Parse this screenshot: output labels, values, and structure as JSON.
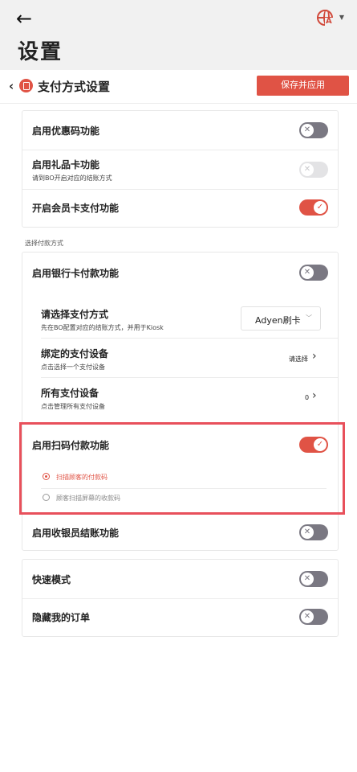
{
  "header": {
    "title": "设置",
    "language_badge": "A"
  },
  "subheader": {
    "title": "支付方式设置",
    "save_label": "保存并应用"
  },
  "card1": {
    "rows": [
      {
        "title": "启用优惠码功能",
        "toggle": "off"
      },
      {
        "title": "启用礼品卡功能",
        "subtitle": "请到BO开启对应的结账方式",
        "toggle": "disabled"
      },
      {
        "title": "开启会员卡支付功能",
        "toggle": "on"
      }
    ]
  },
  "section_label": "选择付款方式",
  "card2": {
    "bank_card": {
      "title": "启用银行卡付款功能",
      "toggle": "off"
    },
    "payment_method": {
      "title": "请选择支付方式",
      "subtitle": "先在BO配置对应的结账方式，并用于Kiosk",
      "selected_value": "Adyen刷卡"
    },
    "bound_device": {
      "title": "绑定的支付设备",
      "subtitle": "点击选择一个支付设备",
      "value": "请选择"
    },
    "all_devices": {
      "title": "所有支付设备",
      "subtitle": "点击管理所有支付设备",
      "value": "0"
    },
    "scan_pay": {
      "title": "启用扫码付款功能",
      "toggle": "on",
      "options": [
        {
          "label": "扫描顾客的付款码",
          "selected": true
        },
        {
          "label": "顾客扫描屏幕的收款码",
          "selected": false
        }
      ]
    },
    "cashier_checkout": {
      "title": "启用收银员结账功能",
      "toggle": "off"
    }
  },
  "card3": {
    "rows": [
      {
        "title": "快速模式",
        "toggle": "off"
      },
      {
        "title": "隐藏我的订单",
        "toggle": "off"
      }
    ]
  },
  "colors": {
    "accent": "#e05345",
    "highlight_border": "#e8505b",
    "toggle_off": "#7a7882"
  }
}
